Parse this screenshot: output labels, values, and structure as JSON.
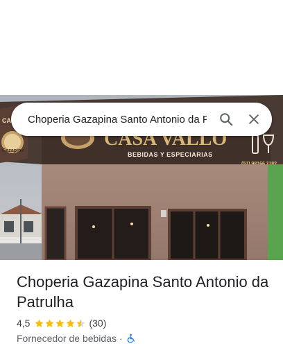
{
  "search": {
    "value": "Choperia Gazapina Santo Antonio da Patrulha",
    "search_icon": "search-icon",
    "clear_icon": "close-icon"
  },
  "photo": {
    "sign_brand": "CASA VALLO",
    "sign_tagline": "BEBIDAS Y ESPECIARIAS",
    "sign_phone": "(51) 98166 1182",
    "sign_logo_text": "Gazapina",
    "side_sign_text": "CASA"
  },
  "place": {
    "name": "Choperia Gazapina Santo Antonio da Patrulha",
    "rating": "4,5",
    "rating_stars": 4.5,
    "review_count": "(30)",
    "category": "Fornecedor de bebidas",
    "separator": "·",
    "accessibility_icon": "wheelchair-icon"
  },
  "colors": {
    "star": "#fbbc04",
    "star_empty": "#dadce0",
    "accessibility": "#1a73e8",
    "text_primary": "#202124",
    "text_secondary": "#5f6368"
  }
}
